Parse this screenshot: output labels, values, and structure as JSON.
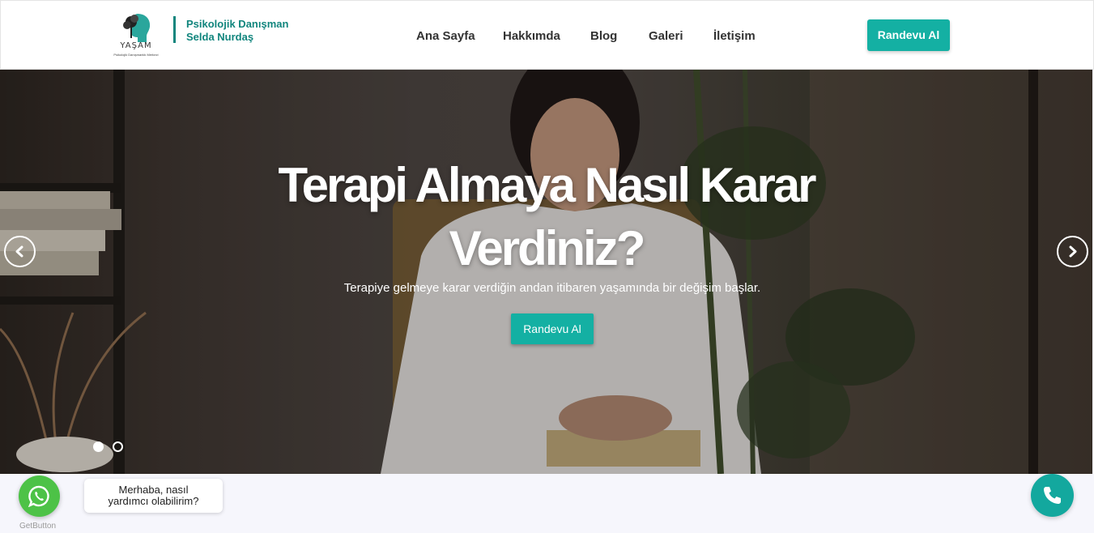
{
  "colors": {
    "brand": "#14b0a3",
    "brand_dark": "#11857d",
    "whatsapp": "#4dc247"
  },
  "header": {
    "logo_word": "YAŞAM",
    "logo_sub": "Psikolojik Danışmanlık Merkezi",
    "brand_line1": "Psikolojik Danışman",
    "brand_line2": "Selda Nurdaş",
    "nav": [
      "Ana Sayfa",
      "Hakkımda",
      "Blog",
      "Galeri",
      "İletişim"
    ],
    "cta": "Randevu Al"
  },
  "hero": {
    "title_line1": "Terapi Almaya Nasıl Karar",
    "title_line2": "Verdiniz?",
    "subtitle": "Terapiye gelmeye karar verdiğin andan itibaren yaşamında bir değişim başlar.",
    "button": "Randevu Al",
    "prev_icon": "chevron-left-icon",
    "next_icon": "chevron-right-icon",
    "slide_count": 2,
    "active_slide": 1
  },
  "widgets": {
    "whatsapp_line1": "Merhaba, nasıl",
    "whatsapp_line2": "yardımcı olabilirim?",
    "whatsapp_brand": "GetButton",
    "whatsapp_icon": "whatsapp-icon",
    "call_icon": "phone-icon"
  }
}
